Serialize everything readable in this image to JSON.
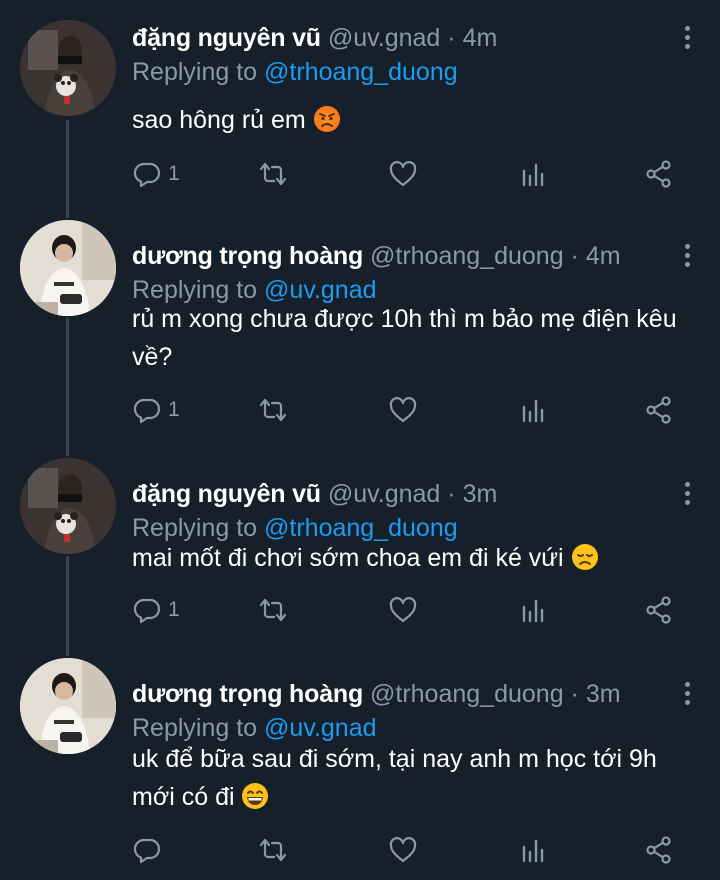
{
  "tweets": [
    {
      "name": "đặng nguyên vũ",
      "handle": "@uv.gnad",
      "dot": "·",
      "time": "4m",
      "replying_prefix": "Replying to",
      "replying_to": "@trhoang_duong",
      "text_line1": "sao hông rủ em",
      "text_line2": "",
      "emoji": "angry-face",
      "reply_count": "1"
    },
    {
      "name": "dương trọng hoàng",
      "handle": "@trhoang_duong",
      "dot": "·",
      "time": "4m",
      "replying_prefix": "Replying to",
      "replying_to": "@uv.gnad",
      "text_line1": "rủ m xong chưa được 10h thì m bảo mẹ điện kêu",
      "text_line2": "về?",
      "emoji": "",
      "reply_count": "1"
    },
    {
      "name": "đặng nguyên vũ",
      "handle": "@uv.gnad",
      "dot": "·",
      "time": "3m",
      "replying_prefix": "Replying to",
      "replying_to": "@trhoang_duong",
      "text_line1": "mai mốt đi chơi sớm choa em đi ké vứi",
      "text_line2": "",
      "emoji": "disappointed-face",
      "reply_count": "1"
    },
    {
      "name": "dương trọng hoàng",
      "handle": "@trhoang_duong",
      "dot": "·",
      "time": "3m",
      "replying_prefix": "Replying to",
      "replying_to": "@uv.gnad",
      "text_line1": "uk để bữa sau đi sớm, tại nay anh m học tới 9h",
      "text_line2": "mới có đi",
      "emoji": "grinning-face",
      "reply_count": ""
    }
  ],
  "colors": {
    "background": "#15202b",
    "secondary_text": "#8b98a5",
    "mention": "#1d9bf0",
    "thread_line": "#38444d"
  },
  "icons": [
    "reply-icon",
    "retweet-icon",
    "like-icon",
    "analytics-icon",
    "share-icon",
    "more-icon"
  ]
}
